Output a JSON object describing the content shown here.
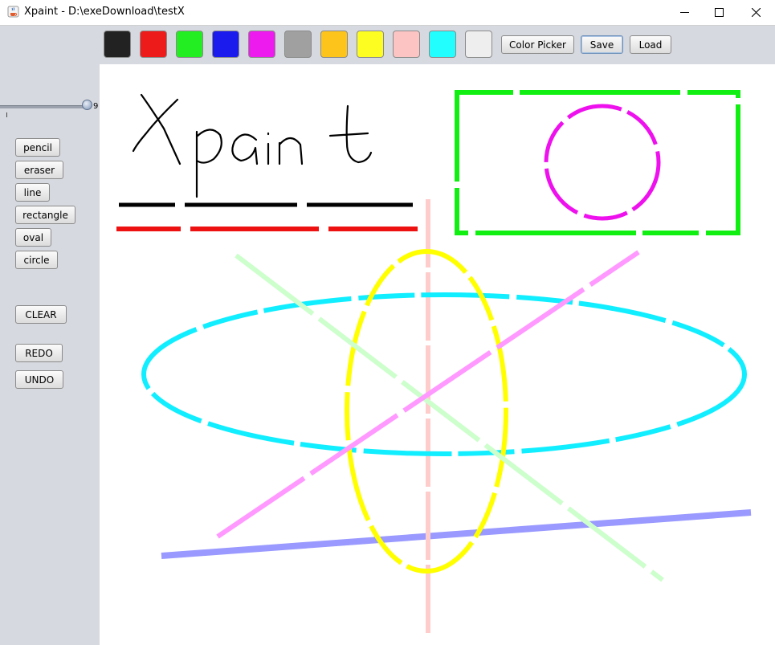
{
  "window": {
    "title": "Xpaint - D:\\exeDownload\\testX",
    "app_icon": "java-cup-icon",
    "controls": [
      "minimize-icon",
      "maximize-icon",
      "close-icon"
    ]
  },
  "palette": {
    "colors": [
      "#222222",
      "#ee1b1b",
      "#22ee22",
      "#1b1bee",
      "#ee1bee",
      "#a0a0a0",
      "#fdc41c",
      "#fdfd22",
      "#fdc4c4",
      "#22fdfd",
      "#eeeeee"
    ],
    "color_picker_label": "Color Picker",
    "save_label": "Save",
    "load_label": "Load"
  },
  "sidebar": {
    "stroke_size_value": "9",
    "tools": [
      "pencil",
      "eraser",
      "line",
      "rectangle",
      "oval",
      "circle"
    ],
    "clear_label": "CLEAR",
    "redo_label": "REDO",
    "undo_label": "UNDO"
  },
  "canvas": {
    "background": "#ffffff",
    "stroke_colors": {
      "black": "#000000",
      "red": "#ee1111",
      "green": "#11ee11",
      "magenta": "#ee11ee",
      "pink": "#ffcccc",
      "yellow": "#ffff00",
      "cyan": "#11eeff",
      "light_green": "#ccffcc",
      "light_magenta": "#ff99ff",
      "periwinkle": "#9999ff"
    }
  }
}
